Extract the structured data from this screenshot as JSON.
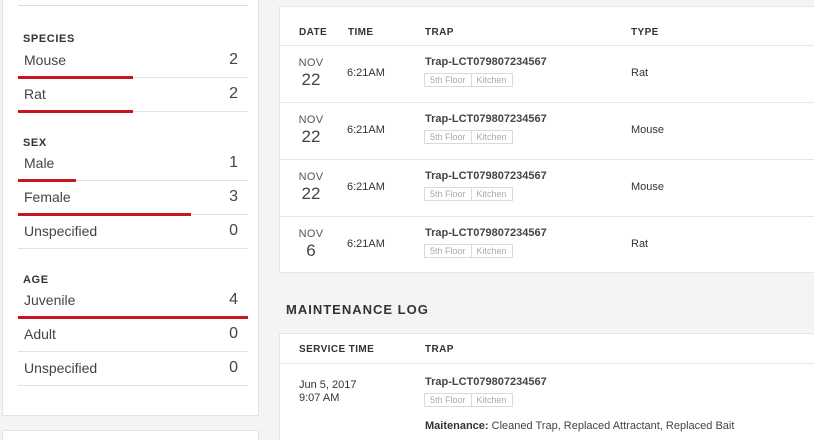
{
  "sidebar": {
    "sections": [
      {
        "title": "SPECIES",
        "items": [
          {
            "label": "Mouse",
            "count": "2",
            "share": 0.5
          },
          {
            "label": "Rat",
            "count": "2",
            "share": 0.5
          }
        ]
      },
      {
        "title": "SEX",
        "items": [
          {
            "label": "Male",
            "count": "1",
            "share": 0.25
          },
          {
            "label": "Female",
            "count": "3",
            "share": 0.75
          },
          {
            "label": "Unspecified",
            "count": "0",
            "share": 0
          }
        ]
      },
      {
        "title": "AGE",
        "items": [
          {
            "label": "Juvenile",
            "count": "4",
            "share": 1.0
          },
          {
            "label": "Adult",
            "count": "0",
            "share": 0
          },
          {
            "label": "Unspecified",
            "count": "0",
            "share": 0
          }
        ]
      }
    ]
  },
  "captures": {
    "columns": {
      "date": "DATE",
      "time": "TIME",
      "trap": "TRAP",
      "type": "TYPE"
    },
    "rows": [
      {
        "month": "NOV",
        "day": "22",
        "time": "6:21AM",
        "trap": "Trap-LCT079807234567",
        "floor": "5th Floor",
        "room": "Kitchen",
        "type": "Rat"
      },
      {
        "month": "NOV",
        "day": "22",
        "time": "6:21AM",
        "trap": "Trap-LCT079807234567",
        "floor": "5th Floor",
        "room": "Kitchen",
        "type": "Mouse"
      },
      {
        "month": "NOV",
        "day": "22",
        "time": "6:21AM",
        "trap": "Trap-LCT079807234567",
        "floor": "5th Floor",
        "room": "Kitchen",
        "type": "Mouse"
      },
      {
        "month": "NOV",
        "day": "6",
        "time": "6:21AM",
        "trap": "Trap-LCT079807234567",
        "floor": "5th Floor",
        "room": "Kitchen",
        "type": "Rat"
      }
    ]
  },
  "maintenance": {
    "title": "MAINTENANCE LOG",
    "columns": {
      "service_time": "SERVICE TIME",
      "trap": "TRAP"
    },
    "entries": [
      {
        "date": "Jun 5, 2017",
        "time": "9:07 AM",
        "trap": "Trap-LCT079807234567",
        "floor": "5th Floor",
        "room": "Kitchen",
        "label": "Maitenance:",
        "description": "Cleaned Trap, Replaced Attractant, Replaced Bait"
      }
    ]
  },
  "colors": {
    "accent": "#c8161e"
  }
}
